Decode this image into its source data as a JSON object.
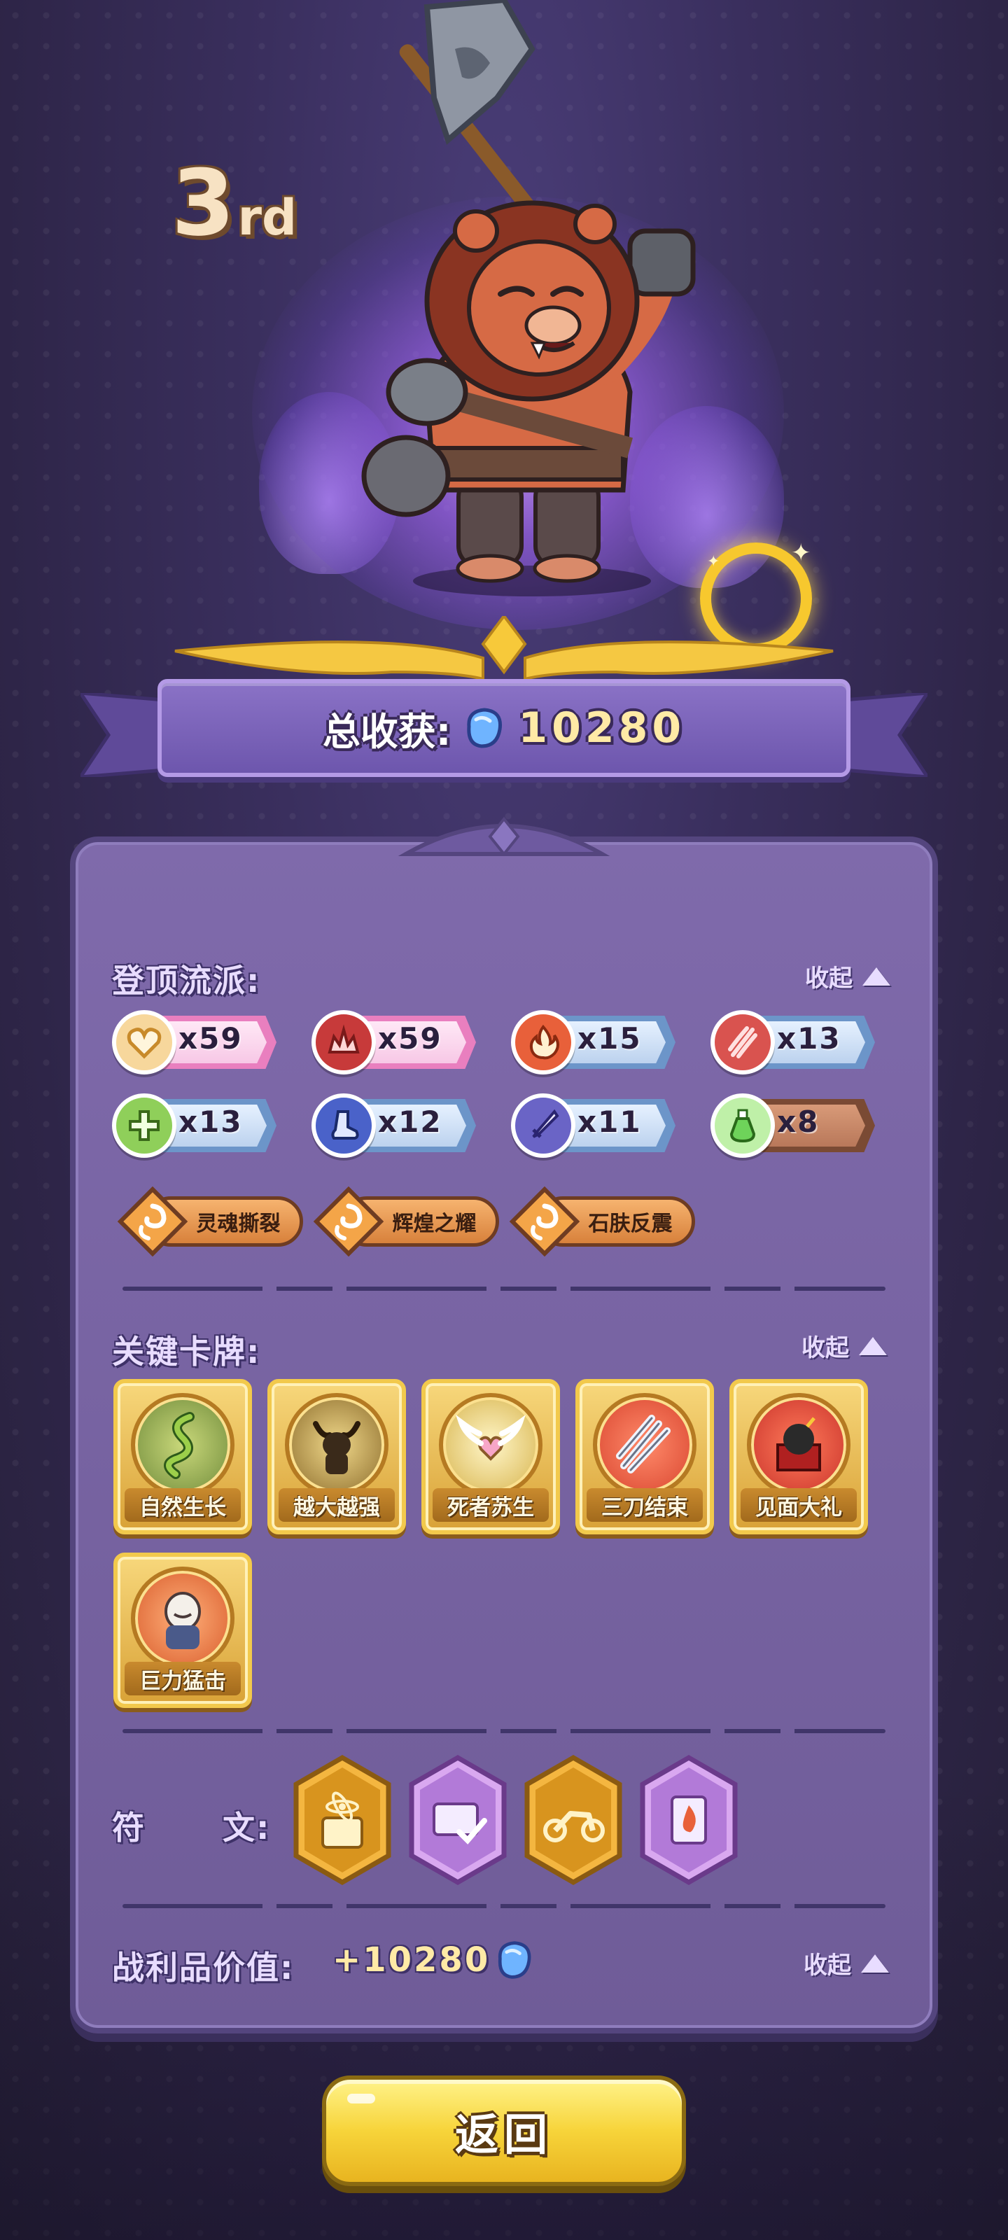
{
  "hero": {
    "rank_number": "3",
    "rank_suffix": "rd"
  },
  "total_harvest": {
    "label": "总收获:",
    "value": "10280",
    "currency_icon": "blue-gem-icon"
  },
  "build_section": {
    "title": "登顶流派:",
    "collapse_label": "收起",
    "stats": [
      {
        "icon": "heart-icon",
        "count": "x59",
        "style": "pink",
        "icon_color": "#f5c26b"
      },
      {
        "icon": "crown-burst-icon",
        "count": "x59",
        "style": "pink",
        "icon_color": "#c73a3a"
      },
      {
        "icon": "fire-icon",
        "count": "x15",
        "style": "blue",
        "icon_color": "#e8603a"
      },
      {
        "icon": "claw-slash-icon",
        "count": "x13",
        "style": "blue",
        "icon_color": "#d9534f"
      },
      {
        "icon": "plus-icon",
        "count": "x13",
        "style": "blue",
        "icon_color": "#8fcf5a"
      },
      {
        "icon": "boot-icon",
        "count": "x12",
        "style": "blue",
        "icon_color": "#4a62c9"
      },
      {
        "icon": "blade-icon",
        "count": "x11",
        "style": "blue",
        "icon_color": "#6a64c6"
      },
      {
        "icon": "potion-icon",
        "count": "x8",
        "style": "brown",
        "icon_color": "#6ed35a"
      }
    ],
    "skills": [
      "灵魂撕裂",
      "辉煌之耀",
      "石肤反震"
    ]
  },
  "cards_section": {
    "title": "关键卡牌:",
    "collapse_label": "收起",
    "cards": [
      {
        "name": "自然生长",
        "icon": "vine-serpent-icon",
        "bg": "#6f8a3a"
      },
      {
        "name": "越大越强",
        "icon": "minotaur-icon",
        "bg": "#8a6a2a"
      },
      {
        "name": "死者苏生",
        "icon": "winged-heart-icon",
        "bg": "#d6b24a"
      },
      {
        "name": "三刀结束",
        "icon": "triple-blade-icon",
        "bg": "#d8442e"
      },
      {
        "name": "见面大礼",
        "icon": "bomb-gift-icon",
        "bg": "#c8322a"
      },
      {
        "name": "巨力猛击",
        "icon": "rage-hero-icon",
        "bg": "#d85a2a"
      }
    ]
  },
  "runes_section": {
    "title": "符",
    "title_2": "文:",
    "runes": [
      {
        "icon": "atom-book-icon",
        "tier": "gold"
      },
      {
        "icon": "card-check-icon",
        "tier": "purple"
      },
      {
        "icon": "motorcycle-icon",
        "tier": "gold"
      },
      {
        "icon": "flame-card-icon",
        "tier": "purple"
      }
    ]
  },
  "loot_section": {
    "title": "战利品价值:",
    "value": "+10280",
    "currency_icon": "blue-gem-icon",
    "collapse_label": "收起"
  },
  "return_button": {
    "label": "返回"
  }
}
